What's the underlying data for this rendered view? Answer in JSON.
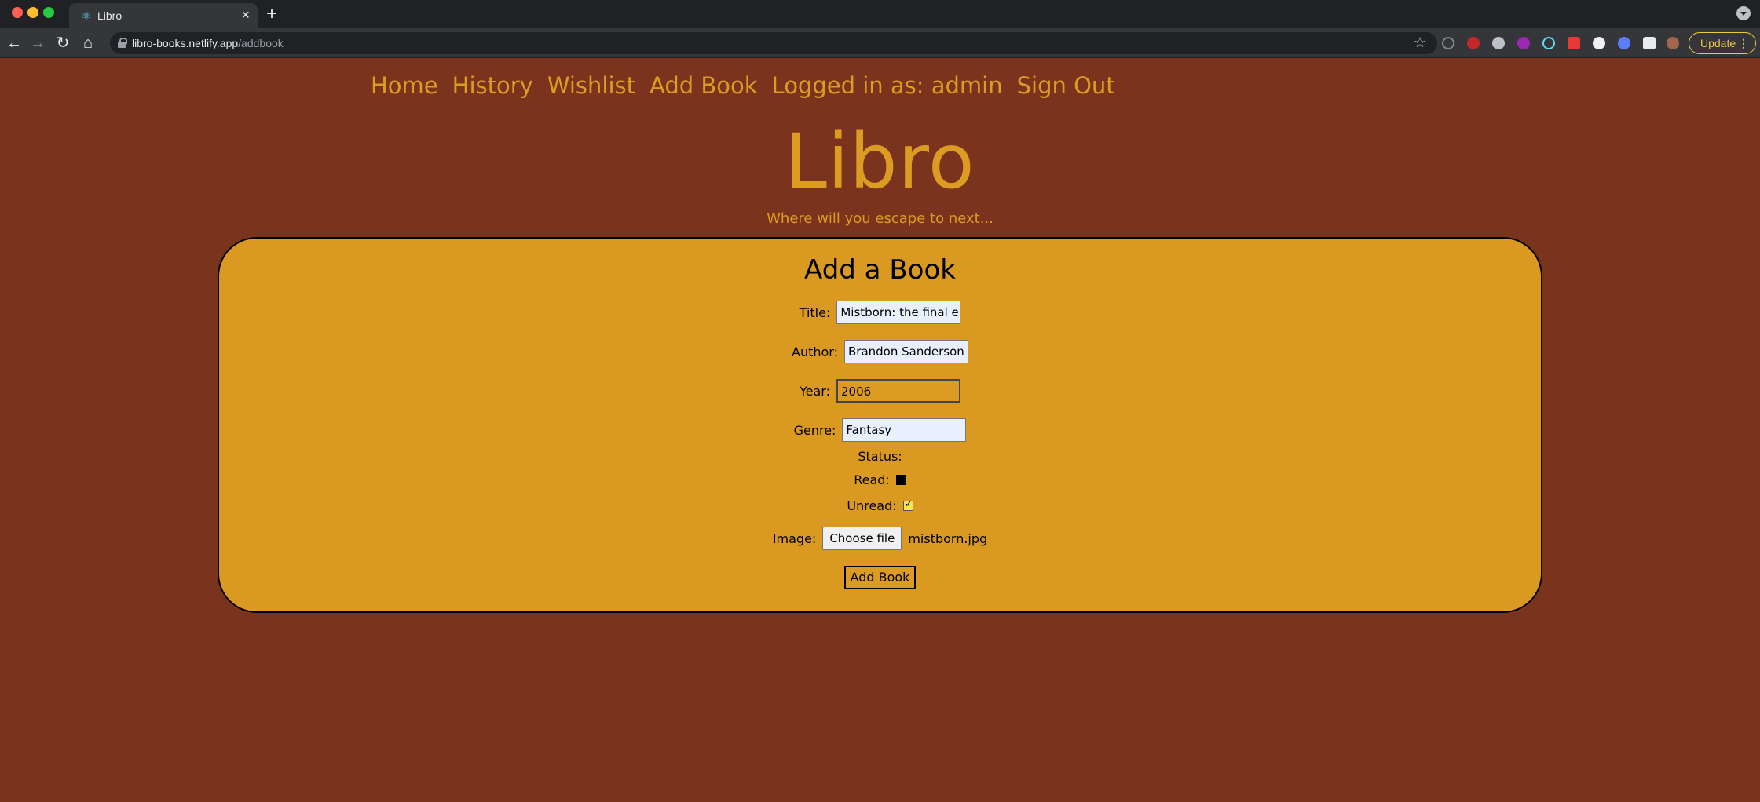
{
  "browser": {
    "tab_title": "Libro",
    "url_domain": "libro-books.netlify.app",
    "url_path": "/addbook",
    "update_label": "Update"
  },
  "nav": {
    "home": "Home",
    "history": "History",
    "wishlist": "Wishlist",
    "add_book": "Add Book",
    "logged_in": "Logged in as: admin",
    "sign_out": "Sign Out"
  },
  "header": {
    "logo": "Libro",
    "tagline": "Where will you escape to next..."
  },
  "form": {
    "title": "Add a Book",
    "title_label": "Title:",
    "title_value": "Mistborn: the final emp",
    "author_label": "Author:",
    "author_value": "Brandon Sanderson",
    "year_label": "Year:",
    "year_value": "2006",
    "genre_label": "Genre:",
    "genre_value": "Fantasy",
    "status_label": "Status:",
    "read_label": "Read:",
    "read_checked": false,
    "unread_label": "Unread:",
    "unread_checked": true,
    "image_label": "Image:",
    "choose_file_label": "Choose file",
    "file_name": "mistborn.jpg",
    "submit_label": "Add Book"
  },
  "colors": {
    "background": "#7a331c",
    "accent": "#dc9b22",
    "card": "#da9a22"
  }
}
